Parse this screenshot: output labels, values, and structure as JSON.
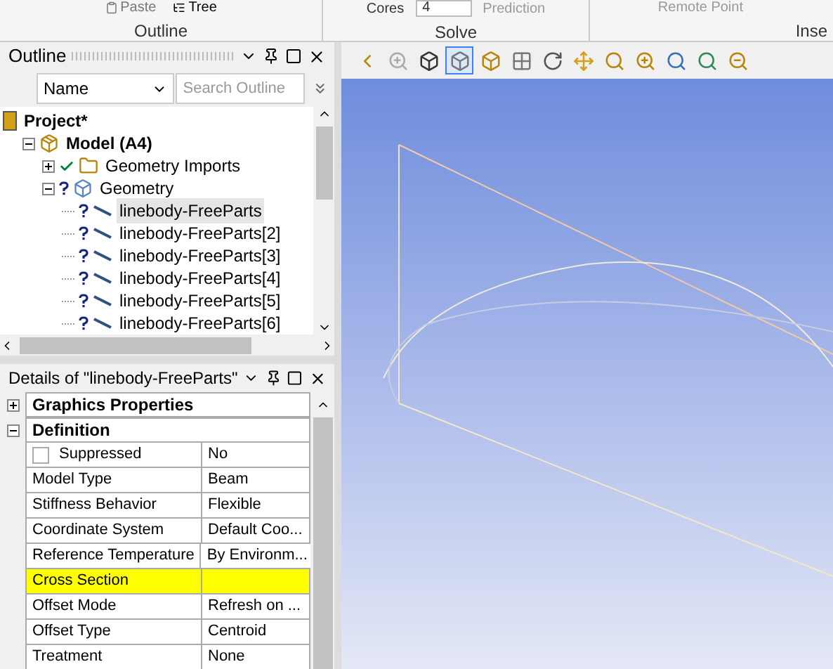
{
  "ribbon": {
    "items": [
      "Paste",
      "Tree",
      "Cores",
      "Prediction",
      "Remote Point"
    ],
    "cores_value": "4",
    "groups": [
      "Outline",
      "Solve",
      "Inse"
    ]
  },
  "outline": {
    "title": "Outline",
    "name_field": "Name",
    "search": {
      "placeholder": "Search Outline"
    },
    "tree": [
      {
        "label": "Project*",
        "bold": true,
        "kind": "project",
        "children": [
          {
            "label": "Model (A4)",
            "bold": true,
            "kind": "model",
            "expanded": true,
            "children": [
              {
                "label": "Geometry Imports",
                "kind": "imports",
                "solved": true,
                "expanded": false
              },
              {
                "label": "Geometry",
                "kind": "geometry",
                "solved": false,
                "expanded": true,
                "children": [
                  {
                    "label": "linebody-FreeParts",
                    "kind": "line",
                    "solved": false,
                    "selected": true
                  },
                  {
                    "label": "linebody-FreeParts[2]",
                    "kind": "line",
                    "solved": false,
                    "selected": false
                  },
                  {
                    "label": "linebody-FreeParts[3]",
                    "kind": "line",
                    "solved": false,
                    "selected": false
                  },
                  {
                    "label": "linebody-FreeParts[4]",
                    "kind": "line",
                    "solved": false,
                    "selected": false
                  },
                  {
                    "label": "linebody-FreeParts[5]",
                    "kind": "line",
                    "solved": false,
                    "selected": false
                  },
                  {
                    "label": "linebody-FreeParts[6]",
                    "kind": "line",
                    "solved": false,
                    "selected": false
                  }
                ]
              }
            ]
          }
        ]
      }
    ]
  },
  "details": {
    "title": "Details of \"linebody-FreeParts\"",
    "groups": [
      {
        "name": "Graphics Properties",
        "expanded": false
      },
      {
        "name": "Definition",
        "expanded": true,
        "rows": [
          {
            "kind": "checkbox",
            "label": "Suppressed",
            "checked": false,
            "value": "No",
            "highlighted": false
          },
          {
            "kind": "text",
            "label": "Model Type",
            "value": "Beam",
            "highlighted": false
          },
          {
            "kind": "text",
            "label": "Stiffness Behavior",
            "value": "Flexible",
            "highlighted": false
          },
          {
            "kind": "text",
            "label": "Coordinate System",
            "value": "Default Coo...",
            "highlighted": false
          },
          {
            "kind": "text",
            "label": "Reference Temperature",
            "value": "By Environm...",
            "highlighted": false
          },
          {
            "kind": "text",
            "label": "Cross Section",
            "highlighted": true
          },
          {
            "kind": "text",
            "label": "Offset Mode",
            "value": "Refresh on ...",
            "highlighted": false
          },
          {
            "kind": "text",
            "label": "Offset Type",
            "value": "Centroid",
            "highlighted": false
          },
          {
            "kind": "text",
            "label": "Treatment",
            "value": "None",
            "highlighted": false
          }
        ]
      }
    ]
  },
  "toolbar": [
    {
      "kind": "zoom-back",
      "selected": false
    },
    {
      "kind": "zoom-next",
      "selected": false
    },
    {
      "kind": "cube-dark",
      "selected": false
    },
    {
      "kind": "cube-shaded",
      "selected": true
    },
    {
      "kind": "cube-edges",
      "selected": false
    },
    {
      "kind": "grid",
      "selected": false
    },
    {
      "kind": "rotate",
      "selected": false
    },
    {
      "kind": "pan",
      "selected": false
    },
    {
      "kind": "zoom",
      "selected": false
    },
    {
      "kind": "zoom-in",
      "selected": false
    },
    {
      "kind": "zoom-fit",
      "selected": false
    },
    {
      "kind": "zoom-box",
      "selected": false
    },
    {
      "kind": "zoom-out",
      "selected": false
    }
  ]
}
